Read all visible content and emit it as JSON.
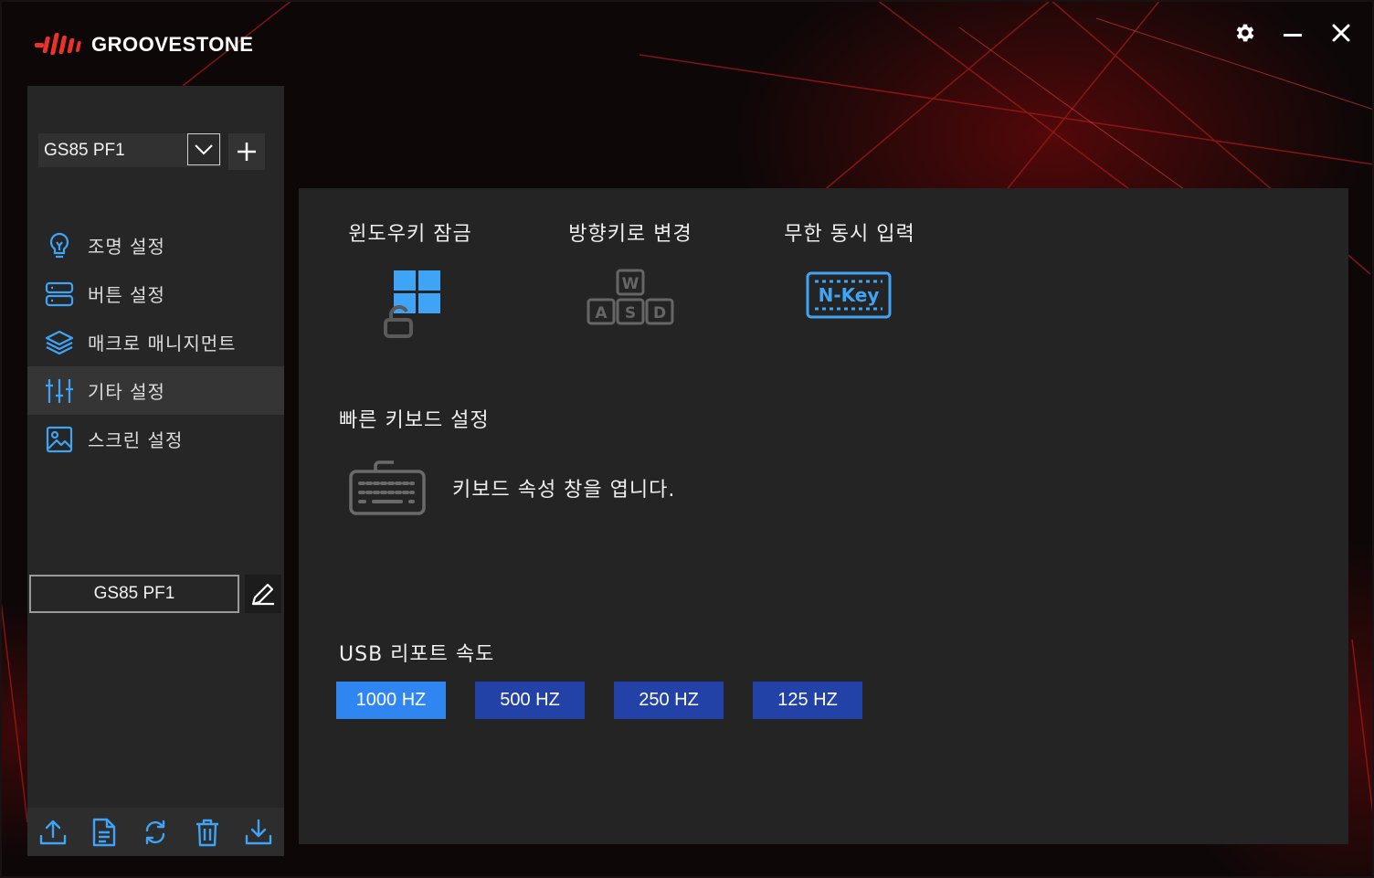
{
  "app": {
    "brand": "GROOVESTONE",
    "accent_color": "#e8322a"
  },
  "window_controls": {
    "settings_icon": "gear-icon",
    "minimize_icon": "minimize-icon",
    "close_icon": "close-icon"
  },
  "sidebar": {
    "profile_select": {
      "value": "GS85 PF1"
    },
    "nav_items": [
      {
        "label": "조명 설정",
        "icon": "lightbulb-icon",
        "active": false
      },
      {
        "label": "버튼 설정",
        "icon": "server-icon",
        "active": false
      },
      {
        "label": "매크로 매니지먼트",
        "icon": "layers-icon",
        "active": false
      },
      {
        "label": "기타 설정",
        "icon": "sliders-icon",
        "active": true
      },
      {
        "label": "스크린 설정",
        "icon": "image-icon",
        "active": false
      }
    ],
    "profile_name": "GS85 PF1",
    "bottom_actions": [
      "upload-icon",
      "document-icon",
      "refresh-icon",
      "trash-icon",
      "download-icon"
    ]
  },
  "main": {
    "features": [
      {
        "title": "윈도우키 잠금",
        "icon": "windows-lock-icon"
      },
      {
        "title": "방향키로 변경",
        "icon": "wasd-icon"
      },
      {
        "title": "무한 동시 입력",
        "icon": "nkey-icon",
        "icon_text": "N-Key"
      }
    ],
    "quick_keyboard": {
      "title": "빠른 키보드 설정",
      "description": "키보드 속성 창을 엽니다."
    },
    "usb_rate": {
      "title": "USB 리포트 속도",
      "options": [
        "1000 HZ",
        "500 HZ",
        "250 HZ",
        "125 HZ"
      ],
      "selected": "1000 HZ",
      "active_color": "#2f86f0",
      "inactive_color": "#2242a8"
    },
    "wasd_keys": [
      "W",
      "A",
      "S",
      "D"
    ]
  }
}
